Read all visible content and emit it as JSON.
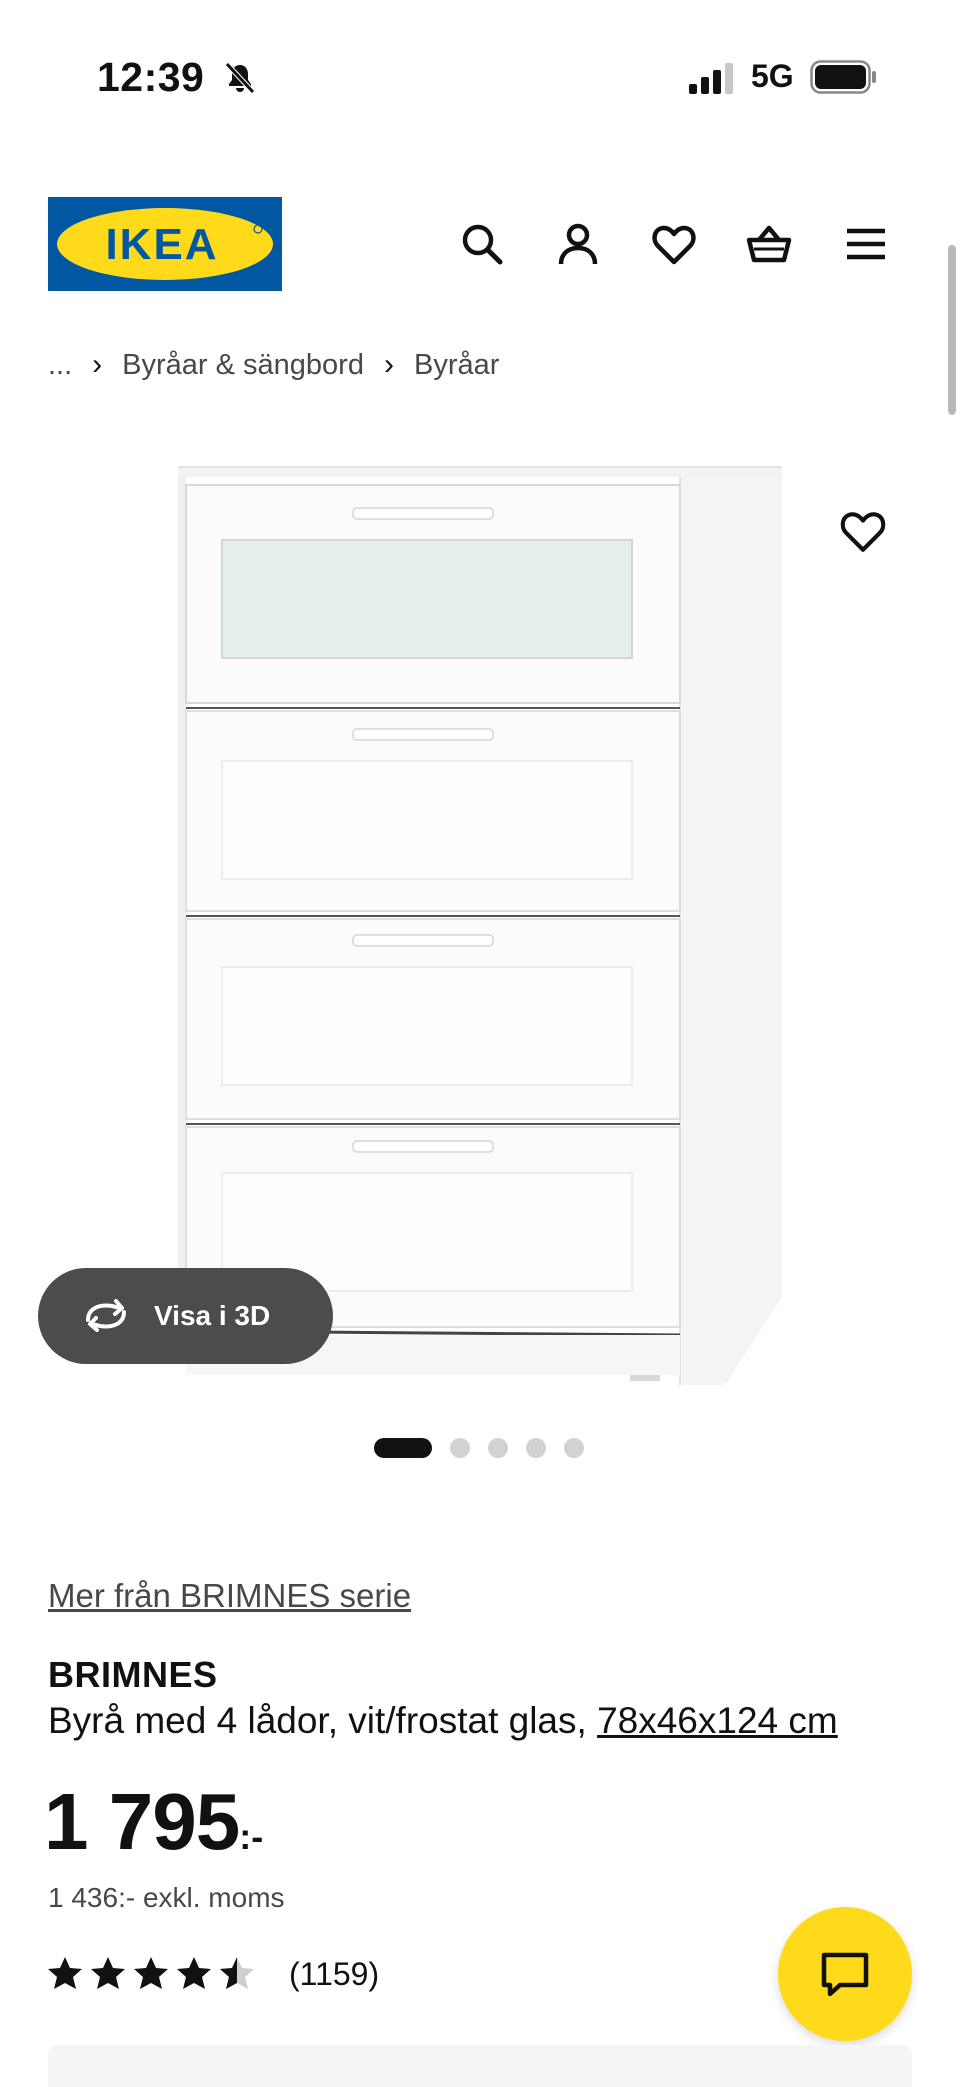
{
  "status_bar": {
    "time": "12:39",
    "network": "5G",
    "icons": [
      "bell-slash-icon",
      "signal-icon",
      "battery-icon"
    ]
  },
  "header": {
    "logo_text": "IKEA",
    "brand_colors": {
      "blue": "#0058a3",
      "yellow": "#ffda1a"
    },
    "icons": [
      "search-icon",
      "user-icon",
      "heart-icon",
      "basket-icon",
      "menu-icon"
    ]
  },
  "breadcrumb": {
    "items": [
      "...",
      "Byråar & sängbord",
      "Byråar"
    ],
    "separator": "›"
  },
  "gallery": {
    "view_3d_label": "Visa i 3D",
    "slide_count": 5,
    "active_slide": 1
  },
  "product": {
    "series_link": "Mer från BRIMNES serie",
    "name": "BRIMNES",
    "description": "Byrå med 4 lådor, vit/frostat glas, ",
    "dimensions": "78x46x124 cm",
    "price_main": "1 795",
    "price_suffix": ":-",
    "price_excl_vat": "1 436:- exkl. moms",
    "rating": 4.5,
    "rating_count": "(1159)"
  },
  "chat": {
    "icon": "chat-icon",
    "color": "#ffda1a"
  }
}
